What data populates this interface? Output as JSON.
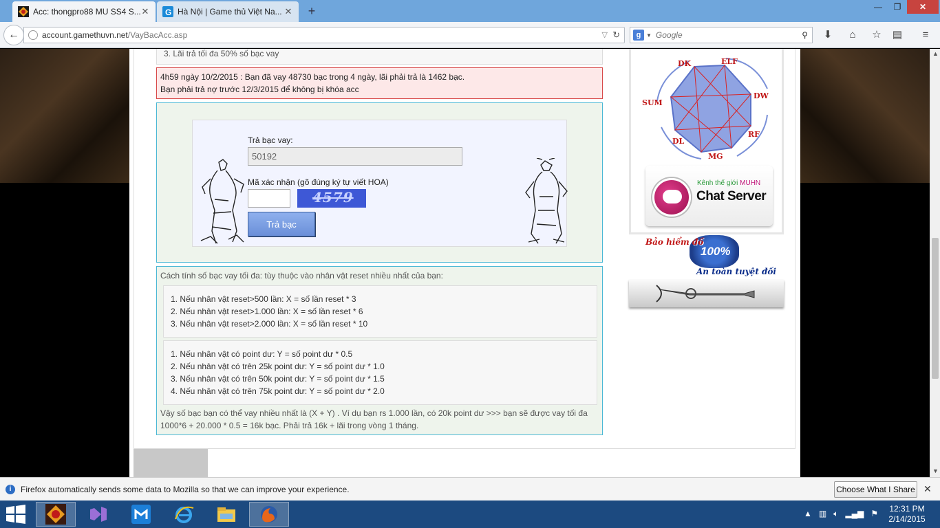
{
  "browser": {
    "tabs": [
      {
        "label": "Acc: thongpro88 MU SS4 S...",
        "active": true
      },
      {
        "label": "Hà Nội | Game thủ Việt Na...",
        "active": false
      }
    ],
    "url_domain": "account.gamethuvn.net",
    "url_path": "/VayBacAcc.asp",
    "search_placeholder": "Google",
    "window_min": "—",
    "window_max": "❐",
    "window_close": "✕",
    "new_tab": "+"
  },
  "page": {
    "note_top": "3. Lãi trả tối đa 50% số bạc vay",
    "warning_line1": "4h59 ngày 10/2/2015 : Bạn đã vay 48730 bạc trong 4 ngày, lãi phải trả là 1462 bạc.",
    "warning_line2": "Bạn phải trả nợ trước 12/3/2015 để không bị khóa acc",
    "form": {
      "amount_label": "Trả bạc vay:",
      "amount_value": "50192",
      "captcha_label": "Mã xác nhận (gõ đúng ký tự viết HOA)",
      "captcha_value": "",
      "captcha_image_text": "4579",
      "submit_label": "Trả bạc"
    },
    "info": {
      "intro": "Cách tính số bạc vay tối đa: tùy thuộc vào nhân vật reset nhiều nhất của bạn:",
      "rules_x": [
        "1. Nếu nhân vật reset>500 lần: X = số lần reset * 3",
        "2. Nếu nhân vật reset>1.000 lần: X = số lần reset * 6",
        "3. Nếu nhân vật reset>2.000 lần: X = số lần reset * 10"
      ],
      "rules_y": [
        "1. Nếu nhân vật có point dư: Y = số point dư * 0.5",
        "2. Nếu nhân vật có trên 25k point dư: Y = số point dư * 1.0",
        "3. Nếu nhân vật có trên 50k point dư: Y = số point dư * 1.5",
        "4. Nếu nhân vật có trên 75k point dư: Y = số point dư * 2.0"
      ],
      "summary": "Vậy số bạc bạn có thể vay nhiều nhất là (X + Y) . Ví dụ bạn rs 1.000 lần, có 20k point dư >>> bạn sẽ được vay tối đa 1000*6 + 20.000 * 0.5 = 16k bạc. Phải trả 16k + lãi trong vòng 1 tháng."
    },
    "sidebar": {
      "classes": [
        "DK",
        "ELF",
        "DW",
        "RF",
        "MG",
        "DL",
        "SUM"
      ],
      "chat_sub_prefix": "Kênh thế giới ",
      "chat_sub_highlight": "MUHN",
      "chat_title": "Chat Server",
      "insurance_title": "Bảo hiểm đồ",
      "insurance_pct": "100%",
      "insurance_sub": "An toàn tuyệt đối"
    }
  },
  "notification": {
    "text": "Firefox automatically sends some data to Mozilla so that we can improve your experience.",
    "button": "Choose What I Share",
    "close": "✕"
  },
  "taskbar": {
    "time": "12:31 PM",
    "date": "2/14/2015"
  }
}
